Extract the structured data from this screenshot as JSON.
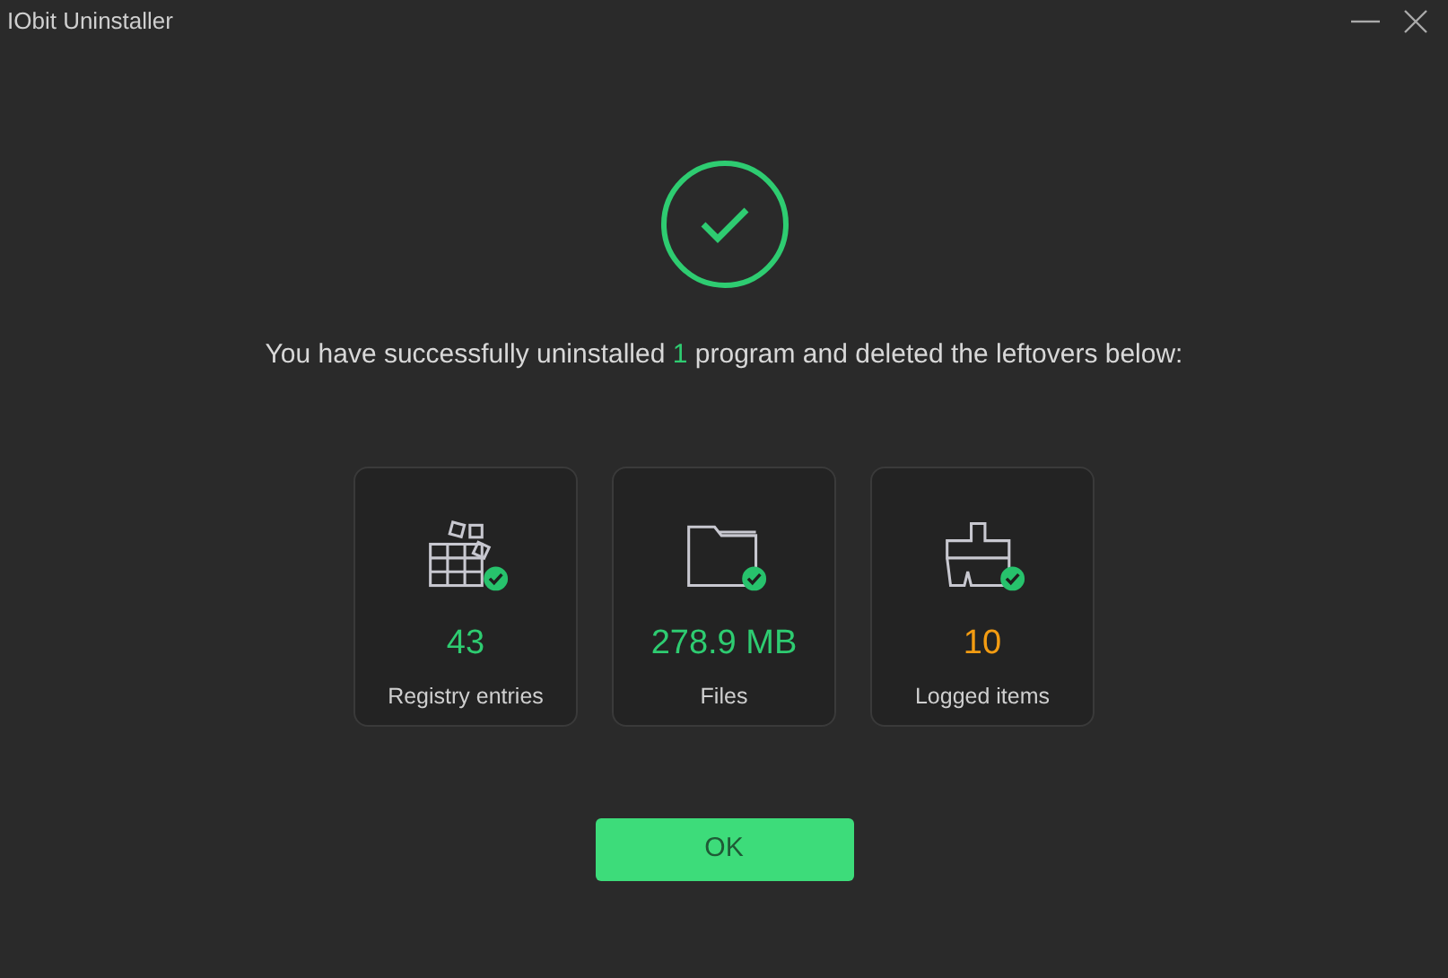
{
  "window": {
    "title": "IObit Uninstaller"
  },
  "message": {
    "before": "You have successfully uninstalled ",
    "count": "1",
    "after": " program and deleted the leftovers below:"
  },
  "cards": [
    {
      "kind": "registry",
      "value": "43",
      "label": "Registry entries",
      "color": "#2ecc71"
    },
    {
      "kind": "files",
      "value": "278.9 MB",
      "label": "Files",
      "color": "#2ecc71"
    },
    {
      "kind": "logs",
      "value": "10",
      "label": "Logged items",
      "color": "#f39c12"
    }
  ],
  "button": "OK"
}
